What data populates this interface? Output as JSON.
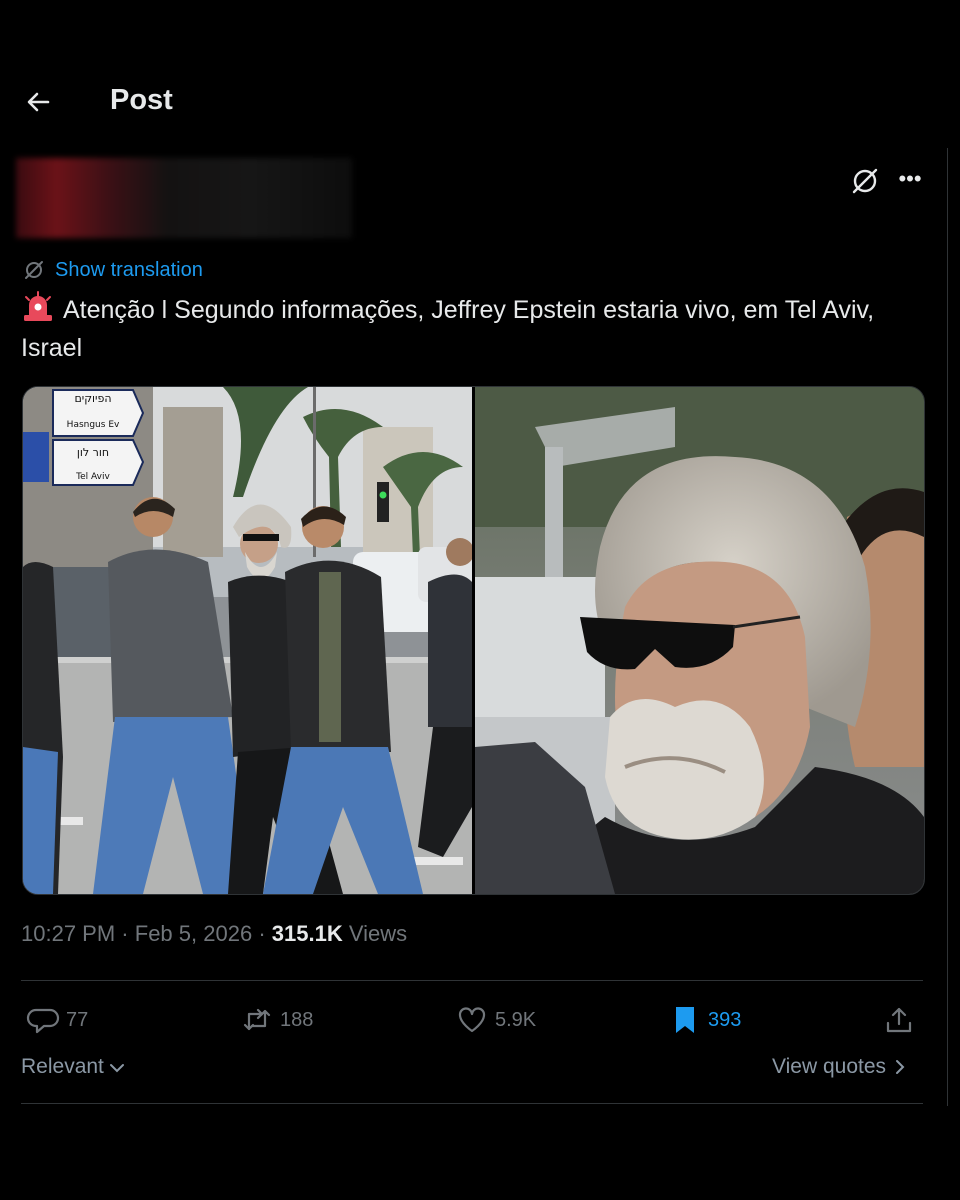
{
  "header": {
    "title": "Post"
  },
  "post": {
    "show_translation": "Show translation",
    "text": "Atenção l Segundo informações, Jeffrey Epstein estaria vivo, em Tel Aviv, Israel",
    "time": "10:27 PM",
    "date": "Feb 5, 2026",
    "views_count": "315.1K",
    "views_label": "Views",
    "sign_lines": [
      "הפיוקים",
      "Hasngus Ev",
      "חור לון",
      "Tel Aviv"
    ]
  },
  "actions": {
    "replies": "77",
    "reposts": "188",
    "likes": "5.9K",
    "bookmarks": "393"
  },
  "footer": {
    "relevant": "Relevant",
    "view_quotes": "View quotes"
  },
  "colors": {
    "accent": "#1d9bf0",
    "muted": "#71767b",
    "text": "#e7e9ea",
    "bg": "#000000"
  }
}
